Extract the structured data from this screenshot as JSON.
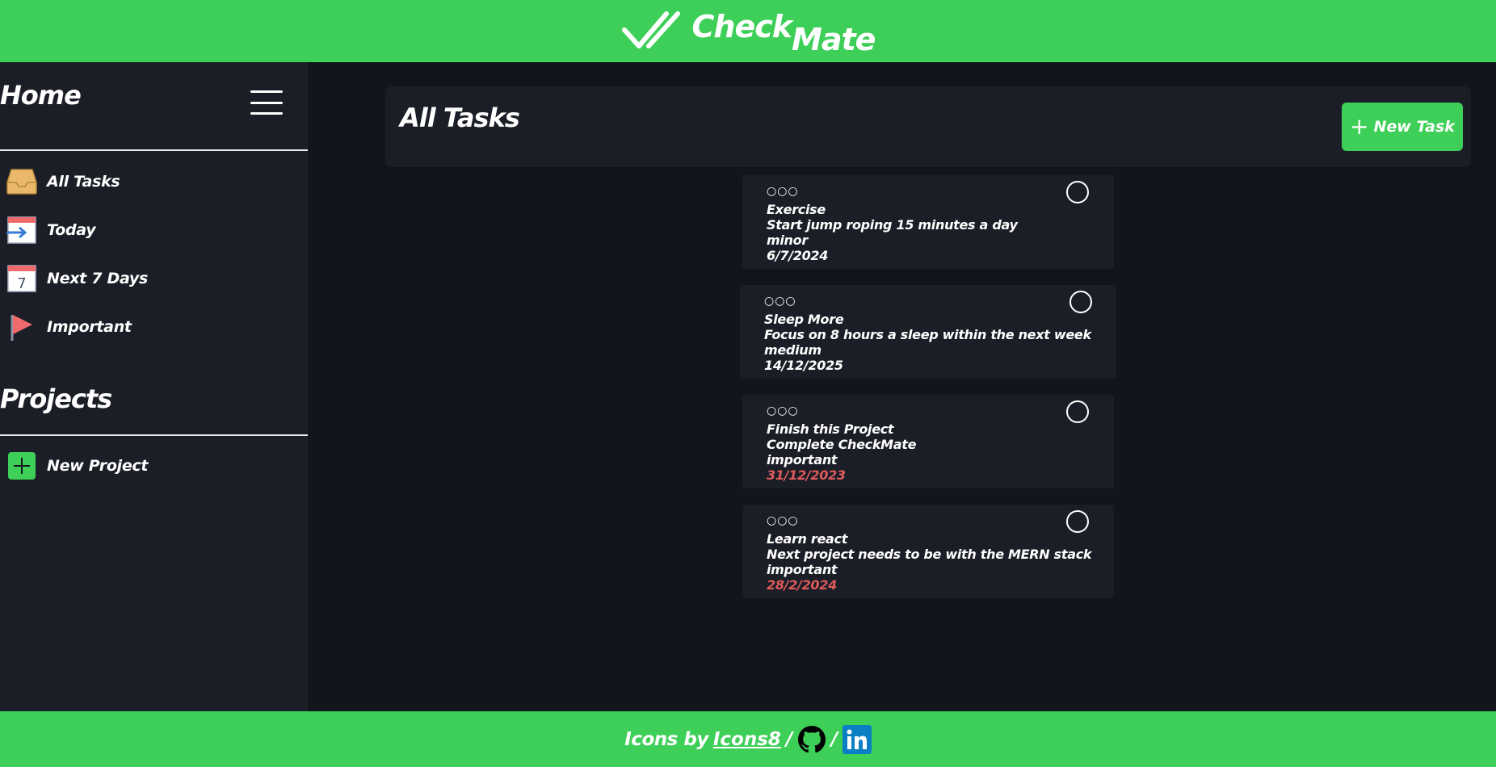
{
  "header": {
    "logo_part1": "Check",
    "logo_part2": "Mate"
  },
  "sidebar": {
    "home_title": "Home",
    "menu_icon": "hamburger-icon",
    "nav": [
      {
        "label": "All Tasks",
        "icon": "inbox-tray-icon"
      },
      {
        "label": "Today",
        "icon": "calendar-arrow-icon"
      },
      {
        "label": "Next 7 Days",
        "icon": "calendar-7-icon"
      },
      {
        "label": "Important",
        "icon": "red-flag-icon"
      }
    ],
    "projects_title": "Projects",
    "new_project_label": "New Project"
  },
  "main": {
    "title": "All Tasks",
    "new_task_label": "New Task",
    "tasks": [
      {
        "dots": "○○○",
        "title": "Exercise",
        "description": "Start jump roping 15 minutes a day",
        "priority": "minor",
        "date": "6/7/2024",
        "overdue": false
      },
      {
        "dots": "○○○",
        "title": "Sleep More",
        "description": "Focus on 8 hours a sleep within the next week",
        "priority": "medium",
        "date": "14/12/2025",
        "overdue": false
      },
      {
        "dots": "○○○",
        "title": "Finish this Project",
        "description": "Complete CheckMate",
        "priority": "important",
        "date": "31/12/2023",
        "overdue": true
      },
      {
        "dots": "○○○",
        "title": "Learn react",
        "description": "Next project needs to be with the MERN stack",
        "priority": "important",
        "date": "28/2/2024",
        "overdue": true
      }
    ]
  },
  "footer": {
    "prefix": "Icons by",
    "link": "Icons8",
    "separator1": "/",
    "separator2": "/"
  },
  "colors": {
    "accent_green": "#3ecf58",
    "background": "#13151c",
    "panel": "#1b1e27",
    "overdue_red": "#e05a5a"
  }
}
